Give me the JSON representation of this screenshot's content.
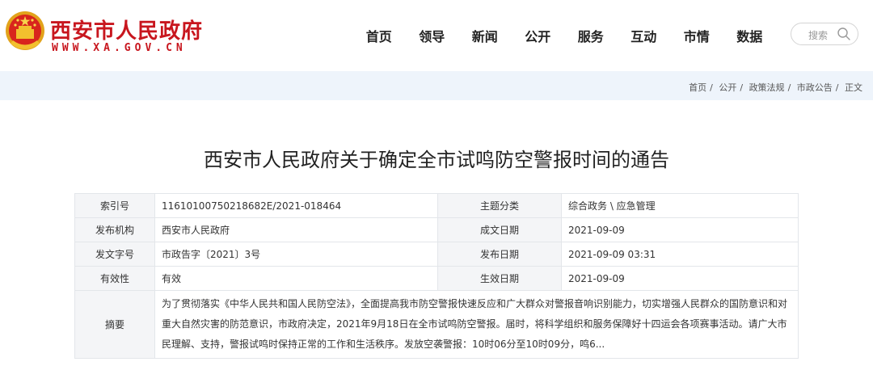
{
  "header": {
    "site_name": "西安市人民政府",
    "site_domain": "WWW.XA.GOV.CN",
    "nav": [
      "首页",
      "领导",
      "新闻",
      "公开",
      "服务",
      "互动",
      "市情",
      "数据"
    ],
    "search_placeholder": "搜索"
  },
  "breadcrumb": {
    "items": [
      "首页",
      "公开",
      "政策法规",
      "市政公告",
      "正文"
    ],
    "separator": "/"
  },
  "article": {
    "title": "西安市人民政府关于确定全市试鸣防空警报时间的通告"
  },
  "meta": {
    "index_label": "索引号",
    "index_value": "11610100750218682E/2021-018464",
    "category_label": "主题分类",
    "category_value": "综合政务 \\ 应急管理",
    "publisher_label": "发布机构",
    "publisher_value": "西安市人民政府",
    "written_label": "成文日期",
    "written_value": "2021-09-09",
    "doc_no_label": "发文字号",
    "doc_no_value": "市政告字〔2021〕3号",
    "published_label": "发布日期",
    "published_value": "2021-09-09 03:31",
    "validity_label": "有效性",
    "validity_value": "有效",
    "effective_label": "生效日期",
    "effective_value": "2021-09-09",
    "summary_label": "摘要",
    "summary_value": "为了贯彻落实《中华人民共和国人民防空法》，全面提高我市防空警报快速反应和广大群众对警报音响识别能力，切实增强人民群众的国防意识和对重大自然灾害的防范意识，市政府决定，2021年9月18日在全市试鸣防空警报。届时，将科学组织和服务保障好十四运会各项赛事活动。请广大市民理解、支持，警报试鸣时保持正常的工作和生活秩序。发放空袭警报：10时06分至10时09分，鸣6..."
  },
  "colors": {
    "brand_red": "#c8161e",
    "band_blue": "#eef4fb",
    "label_cell_bg": "#f4f5f7"
  }
}
